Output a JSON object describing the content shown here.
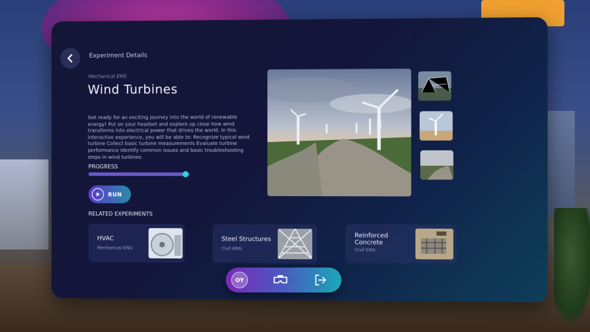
{
  "header": {
    "breadcrumb": "Experiment Details",
    "back_icon": "back-arrow-icon"
  },
  "experiment": {
    "category": "Mechanical ENG",
    "title": "Wind Turbines",
    "description": "Get ready for an exciting journey into the world of renewable energy! Put on your headset and explore up close how wind transforms into electrical power that drives the world.  In this interactive experience, you will be able to: Recognize typical wind turbine Collect basic turbine measurements Evaluate turbine performance Identify common issues and basic troubleshooting steps in wind turbines"
  },
  "progress": {
    "label": "PROGRESS",
    "value": 0.95,
    "fill_color": "#6a5ac8",
    "knob_color": "#2ad4e0"
  },
  "run_button": {
    "label": "RUN",
    "icon": "play-icon"
  },
  "related": {
    "label": "RELATED EXPERIMENTS",
    "items": [
      {
        "name": "HVAC",
        "category": "Mechanical ENG",
        "icon": "hvac-fan-image"
      },
      {
        "name": "Steel Structures",
        "category": "Civil ENG",
        "icon": "steel-structure-image"
      },
      {
        "name": "Reinforced Concrete",
        "category": "Civil ENG",
        "icon": "concrete-image"
      }
    ]
  },
  "toolbar": {
    "items": [
      {
        "label": "OY",
        "icon": "profile-badge-icon"
      },
      {
        "label": "",
        "icon": "vr-headset-icon"
      },
      {
        "label": "",
        "icon": "exit-icon"
      }
    ]
  },
  "colors": {
    "panel_bg": "#141638",
    "accent": "#6a5ac8",
    "accent2": "#2ad4e0"
  }
}
